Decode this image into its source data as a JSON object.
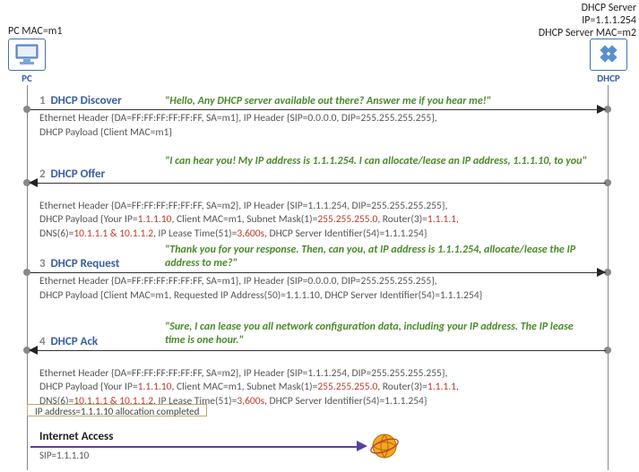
{
  "pc_label": "PC MAC=m1",
  "server_label_line1": "DHCP Server IP=1.1.1.254",
  "server_label_line2": "DHCP Server MAC=m2",
  "pc_caption": "PC",
  "srv_caption": "DHCP",
  "steps": [
    {
      "num": "1",
      "name": "DHCP Discover",
      "quote": "\"Hello, Any DHCP server available out there? Answer me if you hear me!\"",
      "detail_prefix": "Ethernet Header {DA=FF:FF:FF:FF:FF:FF, SA=m1}, IP Header {SIP=0.0.0.0, DIP=255.255.255.255},\nDHCP Payload {Client MAC=m1}"
    },
    {
      "num": "2",
      "name": "DHCP Offer",
      "quote": "\"I can hear you! My IP address is 1.1.1.254. I can allocate/lease an IP address, 1.1.1.10, to you\"",
      "detail_parts": {
        "a": "Ethernet Header {DA=FF:FF:FF:FF:FF:FF, SA=m2}, IP Header {SIP=1.1.1.254, DIP=255.255.255.255},\nDHCP Payload {Your IP=",
        "ip": "1.1.1.10",
        "b": ", Client MAC=m1, Subnet Mask(1)=",
        "mask": "255.255.255.0",
        "c": ", Router(3)=",
        "router": "1.1.1.1",
        "d": ",\nDNS(6)=",
        "dns": "10.1.1.1 & 10.1.1.2",
        "e": ", IP Lease Time(51)=",
        "lease": "3,600s",
        "f": ", DHCP Server Identifier(54)=1.1.1.254}"
      }
    },
    {
      "num": "3",
      "name": "DHCP Request",
      "quote": "\"Thank you for your response. Then, can you, at IP address is 1.1.1.254, allocate/lease the IP address to me?\"",
      "detail_prefix": "Ethernet Header {DA=FF:FF:FF:FF:FF:FF, SA=m1}, IP Header {SIP=0.0.0.0, DIP=255.255.255.255},\nDHCP Payload {Client MAC=m1, Requested IP Address(50)=1.1.1.10, DHCP Server Identifier(54)=1.1.1.254}"
    },
    {
      "num": "4",
      "name": "DHCP Ack",
      "quote": "\"Sure, I can lease you all network configuration data, including your IP address. The IP lease time is one hour.\"",
      "detail_parts": {
        "a": "Ethernet Header {DA=FF:FF:FF:FF:FF:FF, SA=m2}, IP Header {SIP=1.1.1.254, DIP=255.255.255.255},\nDHCP Payload {Your IP=",
        "ip": "1.1.1.10",
        "b": ", Client MAC=m1, Subnet Mask(1)=",
        "mask": "255.255.255.0",
        "c": ", Router(3)=",
        "router": "1.1.1.1",
        "d": ",\nDNS(6)=",
        "dns": "10.1.1.1 & 10.1.1.2",
        "e": ", IP Lease Time(51)=",
        "lease": "3,600s",
        "f": ", DHCP Server Identifier(54)=1.1.1.254}"
      }
    }
  ],
  "note": "IP address=1.1.1.10 allocation completed",
  "internet_label": "Internet Access",
  "sip": "SIP=1.1.1.10",
  "chart_data": {
    "type": "sequence",
    "actors": [
      {
        "name": "PC",
        "mac": "m1"
      },
      {
        "name": "DHCP Server",
        "ip": "1.1.1.254",
        "mac": "m2"
      }
    ],
    "messages": [
      {
        "seq": 1,
        "from": "PC",
        "to": "DHCP",
        "label": "DHCP Discover",
        "ethernet": {
          "DA": "FF:FF:FF:FF:FF:FF",
          "SA": "m1"
        },
        "ip": {
          "SIP": "0.0.0.0",
          "DIP": "255.255.255.255"
        },
        "payload": {
          "Client MAC": "m1"
        }
      },
      {
        "seq": 2,
        "from": "DHCP",
        "to": "PC",
        "label": "DHCP Offer",
        "ethernet": {
          "DA": "FF:FF:FF:FF:FF:FF",
          "SA": "m2"
        },
        "ip": {
          "SIP": "1.1.1.254",
          "DIP": "255.255.255.255"
        },
        "payload": {
          "Your IP": "1.1.1.10",
          "Client MAC": "m1",
          "Subnet Mask(1)": "255.255.255.0",
          "Router(3)": "1.1.1.1",
          "DNS(6)": "10.1.1.1 & 10.1.1.2",
          "IP Lease Time(51)": "3,600s",
          "DHCP Server Identifier(54)": "1.1.1.254"
        }
      },
      {
        "seq": 3,
        "from": "PC",
        "to": "DHCP",
        "label": "DHCP Request",
        "ethernet": {
          "DA": "FF:FF:FF:FF:FF:FF",
          "SA": "m1"
        },
        "ip": {
          "SIP": "0.0.0.0",
          "DIP": "255.255.255.255"
        },
        "payload": {
          "Client MAC": "m1",
          "Requested IP Address(50)": "1.1.1.10",
          "DHCP Server Identifier(54)": "1.1.1.254"
        }
      },
      {
        "seq": 4,
        "from": "DHCP",
        "to": "PC",
        "label": "DHCP Ack",
        "ethernet": {
          "DA": "FF:FF:FF:FF:FF:FF",
          "SA": "m2"
        },
        "ip": {
          "SIP": "1.1.1.254",
          "DIP": "255.255.255.255"
        },
        "payload": {
          "Your IP": "1.1.1.10",
          "Client MAC": "m1",
          "Subnet Mask(1)": "255.255.255.0",
          "Router(3)": "1.1.1.1",
          "DNS(6)": "10.1.1.1 & 10.1.1.2",
          "IP Lease Time(51)": "3,600s",
          "DHCP Server Identifier(54)": "1.1.1.254"
        }
      }
    ],
    "result": {
      "allocated_ip": "1.1.1.10",
      "internet_access_sip": "1.1.1.10"
    }
  }
}
